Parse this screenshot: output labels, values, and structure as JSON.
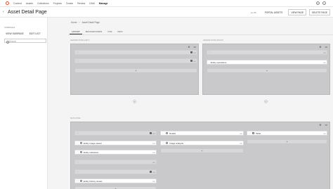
{
  "nav": {
    "items": [
      "Content",
      "Assets",
      "Collections",
      "Projects",
      "Create",
      "Review",
      "DAM",
      "Manage"
    ],
    "active_index": 7
  },
  "header": {
    "back_icon": "arrow-left-icon",
    "title": "Asset Detail Page",
    "language": "en-US",
    "portal_assets": "PORTAL ASSETS",
    "view_page": "VIEW PAGE",
    "delete_page": "DELETE PAGE"
  },
  "sidebar": {
    "section_title": "SUBPAGES",
    "new_subpage": "VIEW SUBPAGE",
    "edit_list": "EDIT LIST",
    "search_placeholder": "Search"
  },
  "breadcrumb": [
    "Home",
    "Asset Detail Page"
  ],
  "tabs": [
    "LAYOUT",
    "BACKGROUNDS",
    "CSS",
    "INFO"
  ],
  "active_tab": 0,
  "zones": {
    "header_left": "HEADER ZONE (LEFT)",
    "header_right": "HEADER ZONE (RIGHT)",
    "main": "MAIN ZONE"
  },
  "cards": {
    "hl_1": "",
    "hl_2": "",
    "hr_1": "",
    "hr_2": "Entity operations",
    "m1_1": "",
    "m1_2": "Entity image viewer",
    "m1_3": "Entity indicators",
    "m1_4": "",
    "m1_5": "",
    "m1_6": "Entity history viewer",
    "m2_1": "Details",
    "m2_2": "Image analysis",
    "m3_1": "Table"
  },
  "symbols": {
    "add": "+",
    "more": "•••",
    "gear": "⚙",
    "drag": "⋮⋮"
  }
}
